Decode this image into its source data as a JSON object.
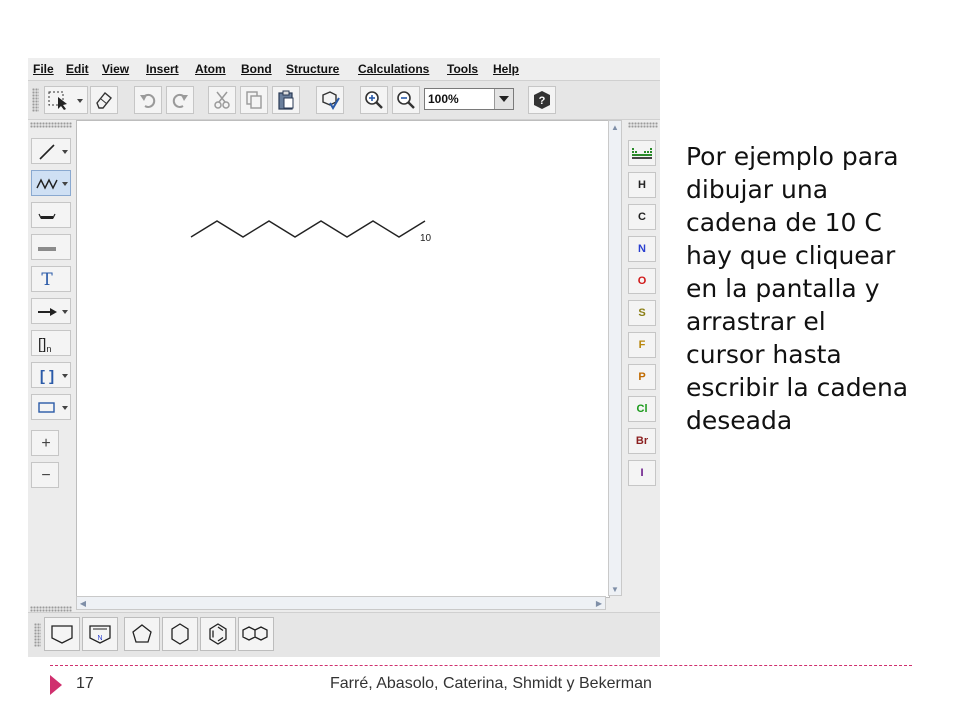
{
  "menubar": {
    "items": [
      {
        "label": "File"
      },
      {
        "label": "Edit"
      },
      {
        "label": "View"
      },
      {
        "label": "Insert"
      },
      {
        "label": "Atom"
      },
      {
        "label": "Bond"
      },
      {
        "label": "Structure"
      },
      {
        "label": "Calculations"
      },
      {
        "label": "Tools"
      },
      {
        "label": "Help"
      }
    ]
  },
  "toolbar": {
    "zoom_value": "100%",
    "icons": [
      "select-icon",
      "eraser-icon",
      "undo-icon",
      "redo-icon",
      "cut-icon",
      "copy-icon",
      "paste-icon",
      "clean-structure-icon",
      "zoom-in-icon",
      "zoom-out-icon",
      "help-icon"
    ]
  },
  "left_tools": [
    {
      "name": "single-bond-tool",
      "icon": "bond-line-icon"
    },
    {
      "name": "chain-tool",
      "icon": "chain-icon",
      "active": true
    },
    {
      "name": "bold-bond-tool",
      "icon": "bold-bond-icon"
    },
    {
      "name": "hashed-bond-tool",
      "icon": "hashed-bond-icon"
    },
    {
      "name": "text-tool",
      "icon": "text-icon",
      "label": "T"
    },
    {
      "name": "arrow-tool",
      "icon": "arrow-icon"
    },
    {
      "name": "repeating-unit-tool",
      "icon": "repeating-unit-icon",
      "label": "[]",
      "sub": "n"
    },
    {
      "name": "bracket-tool",
      "icon": "bracket-icon",
      "label": "[ ]"
    },
    {
      "name": "rectangle-tool",
      "icon": "rectangle-icon"
    },
    {
      "name": "positive-charge-tool",
      "icon": "plus-icon",
      "label": "+"
    },
    {
      "name": "negative-charge-tool",
      "icon": "minus-icon",
      "label": "−"
    }
  ],
  "canvas": {
    "chain_label": "10"
  },
  "elements": [
    {
      "symbol": "H",
      "color": "#222222"
    },
    {
      "symbol": "C",
      "color": "#222222"
    },
    {
      "symbol": "N",
      "color": "#2a3fd0"
    },
    {
      "symbol": "O",
      "color": "#d01818"
    },
    {
      "symbol": "S",
      "color": "#8a7d12"
    },
    {
      "symbol": "F",
      "color": "#b8860b"
    },
    {
      "symbol": "P",
      "color": "#c06a00"
    },
    {
      "symbol": "Cl",
      "color": "#1a9a1a"
    },
    {
      "symbol": "Br",
      "color": "#8b2020"
    },
    {
      "symbol": "I",
      "color": "#6a1a8a"
    }
  ],
  "templates": [
    "cyclopropane-template-icon",
    "pyrrole-template-icon",
    "cyclopentane-template-icon",
    "cyclohexane-template-icon",
    "benzene-template-icon",
    "naphthalene-template-icon"
  ],
  "slide": {
    "lines": [
      "Por ejemplo para",
      "dibujar una",
      "cadena de 10 C",
      "hay que cliquear",
      "en la pantalla y",
      "arrastrar el",
      "cursor hasta",
      "escribir la cadena",
      "deseada"
    ],
    "page_number": "17",
    "author": "Farré, Abasolo, Caterina, Shmidt y Bekerman"
  }
}
